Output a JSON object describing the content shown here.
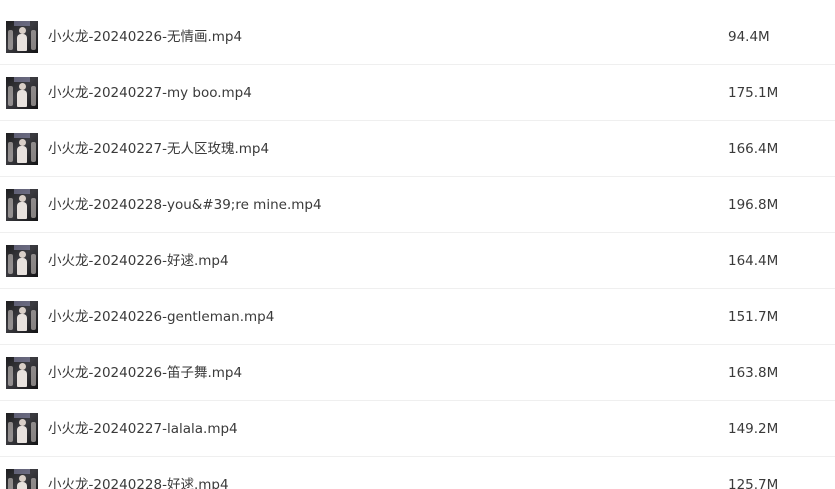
{
  "files": [
    {
      "name": "小火龙-20240226-无情画.mp4",
      "size": "94.4M",
      "thumbnail_icon": "video-thumbnail"
    },
    {
      "name": "小火龙-20240227-my boo.mp4",
      "size": "175.1M",
      "thumbnail_icon": "video-thumbnail"
    },
    {
      "name": "小火龙-20240227-无人区玫瑰.mp4",
      "size": "166.4M",
      "thumbnail_icon": "video-thumbnail"
    },
    {
      "name": "小火龙-20240228-you&#39;re mine.mp4",
      "size": "196.8M",
      "thumbnail_icon": "video-thumbnail"
    },
    {
      "name": "小火龙-20240226-好逑.mp4",
      "size": "164.4M",
      "thumbnail_icon": "video-thumbnail"
    },
    {
      "name": "小火龙-20240226-gentleman.mp4",
      "size": "151.7M",
      "thumbnail_icon": "video-thumbnail"
    },
    {
      "name": "小火龙-20240226-笛子舞.mp4",
      "size": "163.8M",
      "thumbnail_icon": "video-thumbnail"
    },
    {
      "name": "小火龙-20240227-lalala.mp4",
      "size": "149.2M",
      "thumbnail_icon": "video-thumbnail"
    },
    {
      "name": "小火龙-20240228-好逑.mp4",
      "size": "125.7M",
      "thumbnail_icon": "video-thumbnail"
    }
  ]
}
